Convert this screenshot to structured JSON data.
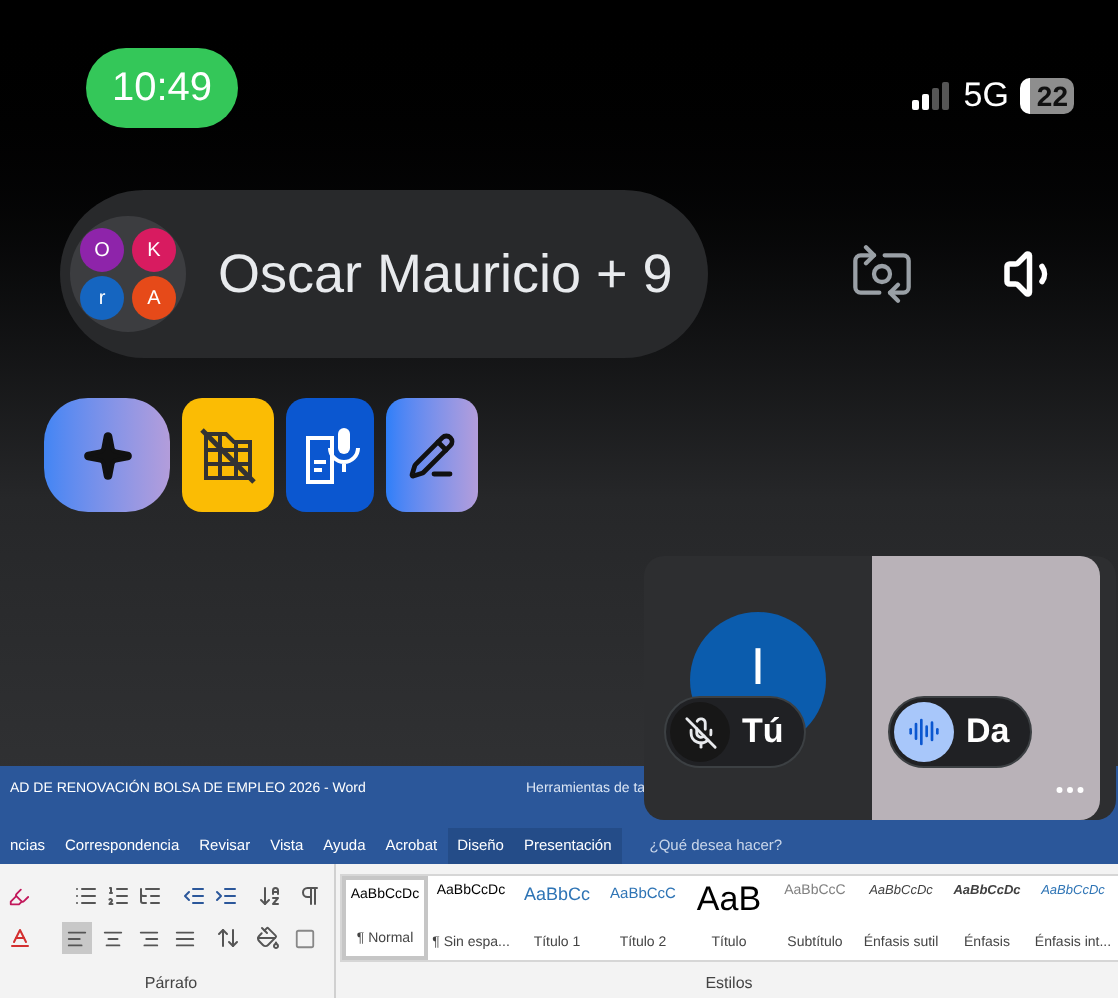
{
  "status_bar": {
    "time": "10:49",
    "network": "5G",
    "battery": "22"
  },
  "call": {
    "title": "Oscar Mauricio + 9",
    "avatars": [
      {
        "letter": "O",
        "color": "#8e24aa"
      },
      {
        "letter": "K",
        "color": "#d81b60"
      },
      {
        "letter": "r",
        "color": "#1565c0"
      },
      {
        "letter": "A",
        "color": "#e64a19"
      }
    ]
  },
  "shared_screen": {
    "title": "AD DE RENOVACIÓN BOLSA DE EMPLEO 2026  -  Word",
    "context_title": "Herramientas de ta",
    "tabs": [
      {
        "label": "ncias",
        "contextual": false
      },
      {
        "label": "Correspondencia",
        "contextual": false
      },
      {
        "label": "Revisar",
        "contextual": false
      },
      {
        "label": "Vista",
        "contextual": false
      },
      {
        "label": "Ayuda",
        "contextual": false
      },
      {
        "label": "Acrobat",
        "contextual": false
      },
      {
        "label": "Diseño",
        "contextual": true
      },
      {
        "label": "Presentación",
        "contextual": true
      }
    ],
    "tell_me": "¿Qué desea hacer?",
    "alignment_buttons": [
      {
        "kind": "left",
        "selected": true
      },
      {
        "kind": "center",
        "selected": false
      },
      {
        "kind": "right",
        "selected": false
      },
      {
        "kind": "justify",
        "selected": false
      }
    ],
    "paragraph_group": "Párrafo",
    "styles_group": "Estilos",
    "styles": [
      {
        "preview": "AaBbCcDc",
        "name": "¶ Normal",
        "kind": "plain",
        "selected": true
      },
      {
        "preview": "AaBbCcDc",
        "name": "¶ Sin espa...",
        "kind": "plain",
        "selected": false
      },
      {
        "preview": "AaBbCc",
        "name": "Título 1",
        "kind": "heading",
        "selected": false
      },
      {
        "preview": "AaBbCcC",
        "name": "Título 2",
        "kind": "subheading",
        "selected": false
      },
      {
        "preview": "AaB",
        "name": "Título",
        "kind": "title",
        "selected": false
      },
      {
        "preview": "AaBbCcC",
        "name": "Subtítulo",
        "kind": "subtle",
        "selected": false
      },
      {
        "preview": "AaBbCcDc",
        "name": "Énfasis sutil",
        "kind": "italic",
        "selected": false
      },
      {
        "preview": "AaBbCcDc",
        "name": "Énfasis",
        "kind": "bold-italic",
        "selected": false
      },
      {
        "preview": "AaBbCcDc",
        "name": "Énfasis int...",
        "kind": "accent-italic",
        "selected": false
      }
    ]
  },
  "tiles": [
    {
      "kind": "avatar",
      "initial": "I",
      "label": "Tú",
      "muted": true
    },
    {
      "kind": "video",
      "label": "Da",
      "muted": false
    }
  ]
}
